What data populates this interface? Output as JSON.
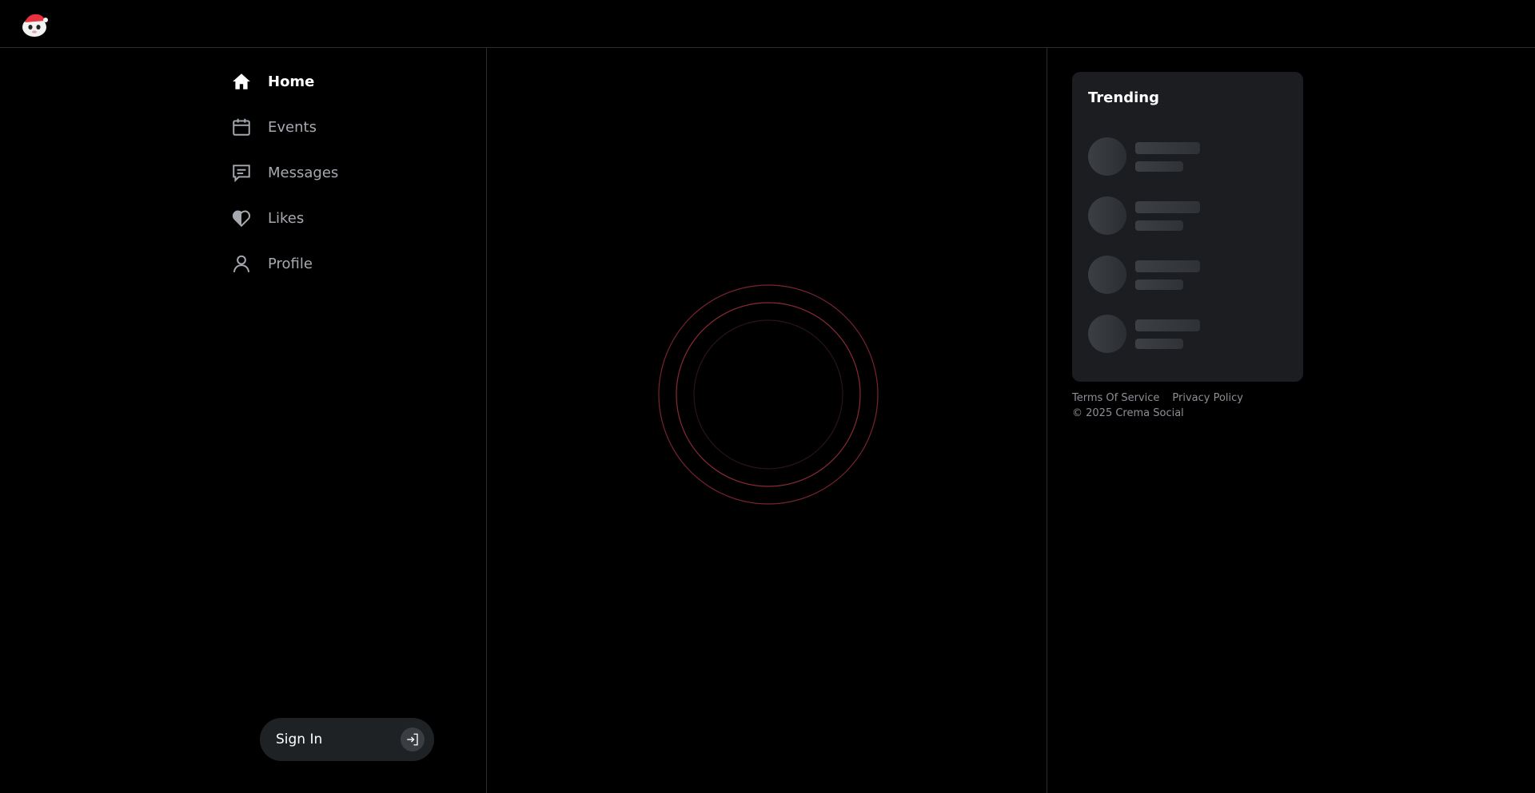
{
  "app": {
    "logo_icon": "crema-mascot-logo"
  },
  "sidebar": {
    "items": [
      {
        "label": "Home",
        "icon": "home-icon",
        "active": true
      },
      {
        "label": "Events",
        "icon": "calendar-icon",
        "active": false
      },
      {
        "label": "Messages",
        "icon": "message-icon",
        "active": false
      },
      {
        "label": "Likes",
        "icon": "heart-icon",
        "active": false
      },
      {
        "label": "Profile",
        "icon": "user-icon",
        "active": false
      }
    ],
    "signin_label": "Sign In"
  },
  "main": {
    "loading": true,
    "spinner_color": "#c23a4a"
  },
  "trending": {
    "title": "Trending",
    "skeleton_rows": 4
  },
  "footer": {
    "terms": "Terms Of Service",
    "privacy": "Privacy Policy",
    "copyright": "© 2025 Crema Social"
  },
  "colors": {
    "background": "#000000",
    "card": "#1b1d20",
    "muted_text": "#a6aab0",
    "accent": "#c23a4a"
  }
}
